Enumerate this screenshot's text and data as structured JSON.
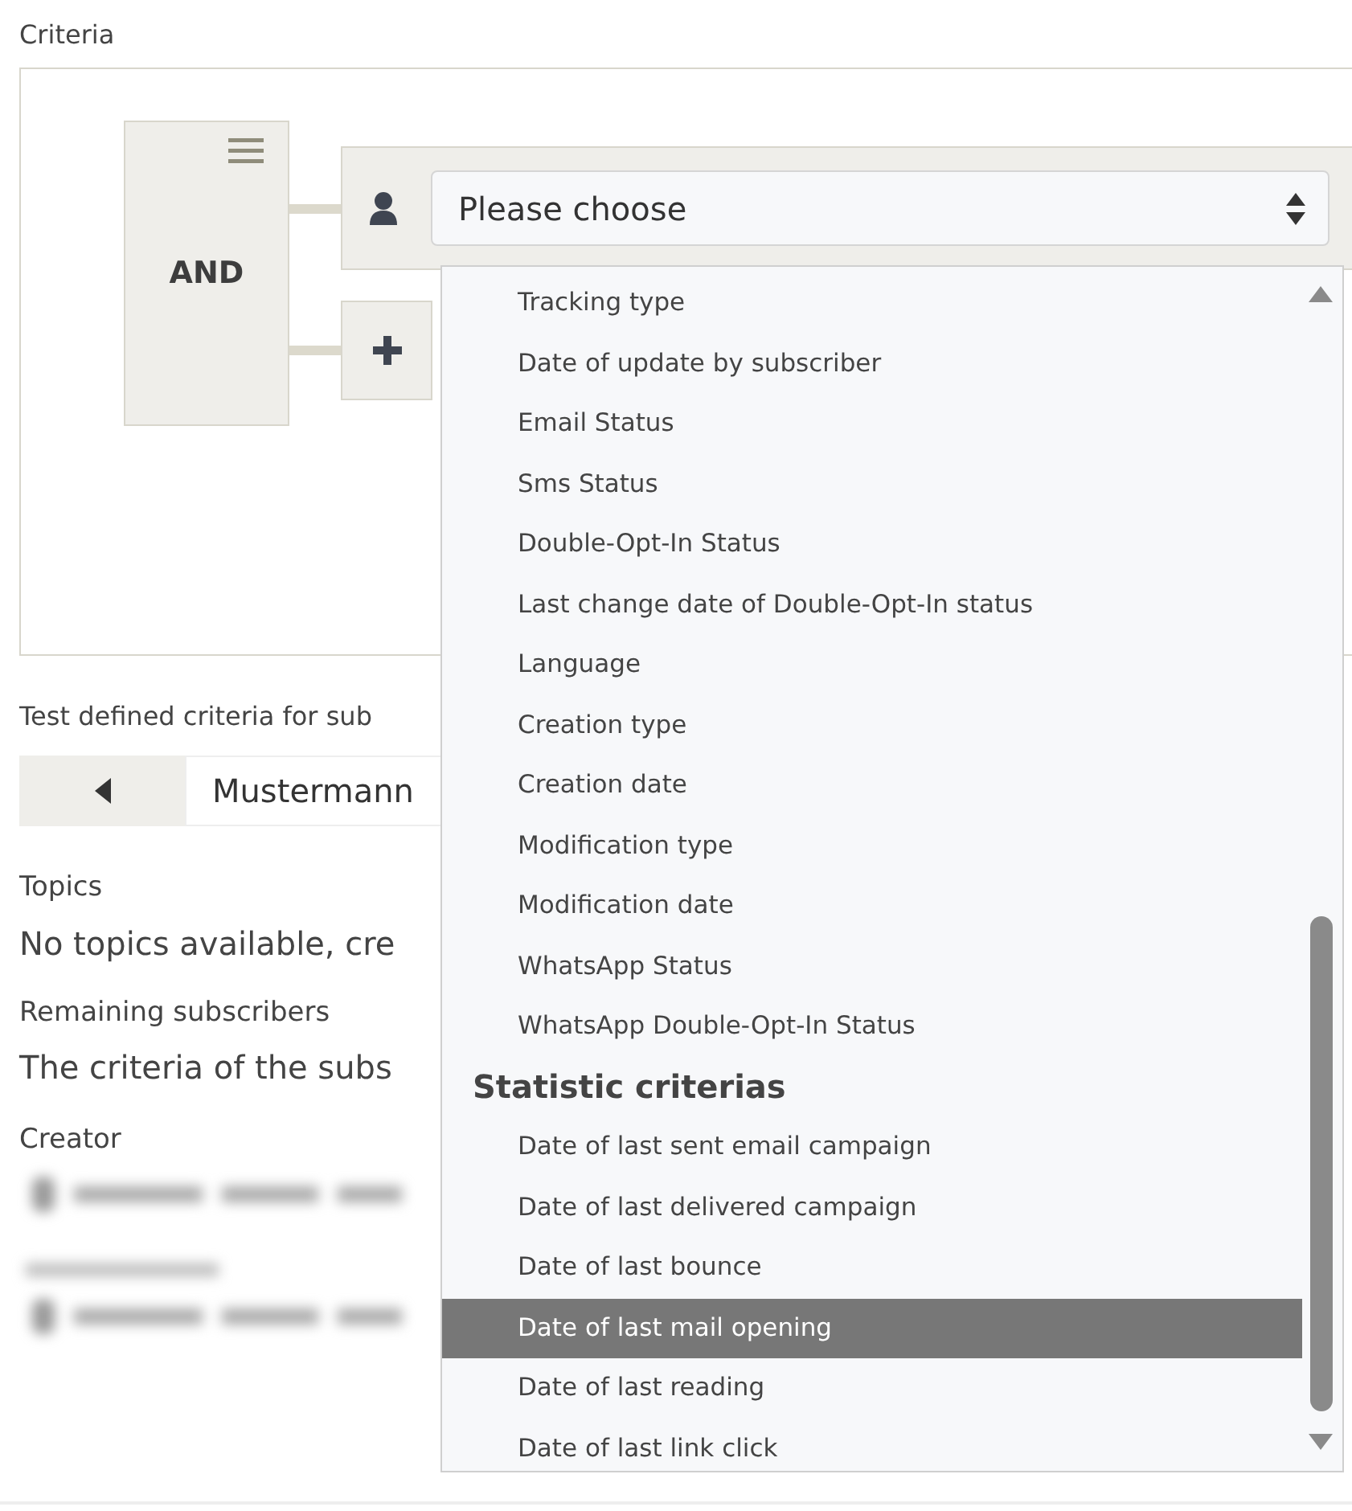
{
  "criteria": {
    "label": "Criteria",
    "operator": "AND",
    "select": {
      "value": "Please choose"
    }
  },
  "dropdown": {
    "items": [
      {
        "kind": "option",
        "label": "Tracking type",
        "selected": false
      },
      {
        "kind": "option",
        "label": "Date of update by subscriber",
        "selected": false
      },
      {
        "kind": "option",
        "label": "Email Status",
        "selected": false
      },
      {
        "kind": "option",
        "label": "Sms Status",
        "selected": false
      },
      {
        "kind": "option",
        "label": "Double-Opt-In Status",
        "selected": false
      },
      {
        "kind": "option",
        "label": "Last change date of Double-Opt-In status",
        "selected": false
      },
      {
        "kind": "option",
        "label": "Language",
        "selected": false
      },
      {
        "kind": "option",
        "label": "Creation type",
        "selected": false
      },
      {
        "kind": "option",
        "label": "Creation date",
        "selected": false
      },
      {
        "kind": "option",
        "label": "Modification type",
        "selected": false
      },
      {
        "kind": "option",
        "label": "Modification date",
        "selected": false
      },
      {
        "kind": "option",
        "label": "WhatsApp Status",
        "selected": false
      },
      {
        "kind": "option",
        "label": "WhatsApp Double-Opt-In Status",
        "selected": false
      },
      {
        "kind": "group",
        "label": "Statistic criterias"
      },
      {
        "kind": "option",
        "label": "Date of last sent email campaign",
        "selected": false
      },
      {
        "kind": "option",
        "label": "Date of last delivered campaign",
        "selected": false
      },
      {
        "kind": "option",
        "label": "Date of last bounce",
        "selected": false
      },
      {
        "kind": "option",
        "label": "Date of last mail opening",
        "selected": true
      },
      {
        "kind": "option",
        "label": "Date of last reading",
        "selected": false
      },
      {
        "kind": "option",
        "label": "Date of last link click",
        "selected": false
      }
    ]
  },
  "test": {
    "label": "Test defined criteria for sub",
    "value": "Mustermann"
  },
  "topics": {
    "label": "Topics",
    "text": "No topics available, cre"
  },
  "remaining": {
    "label": "Remaining subscribers",
    "text": "The criteria of the subs"
  },
  "creator": {
    "label": "Creator"
  }
}
